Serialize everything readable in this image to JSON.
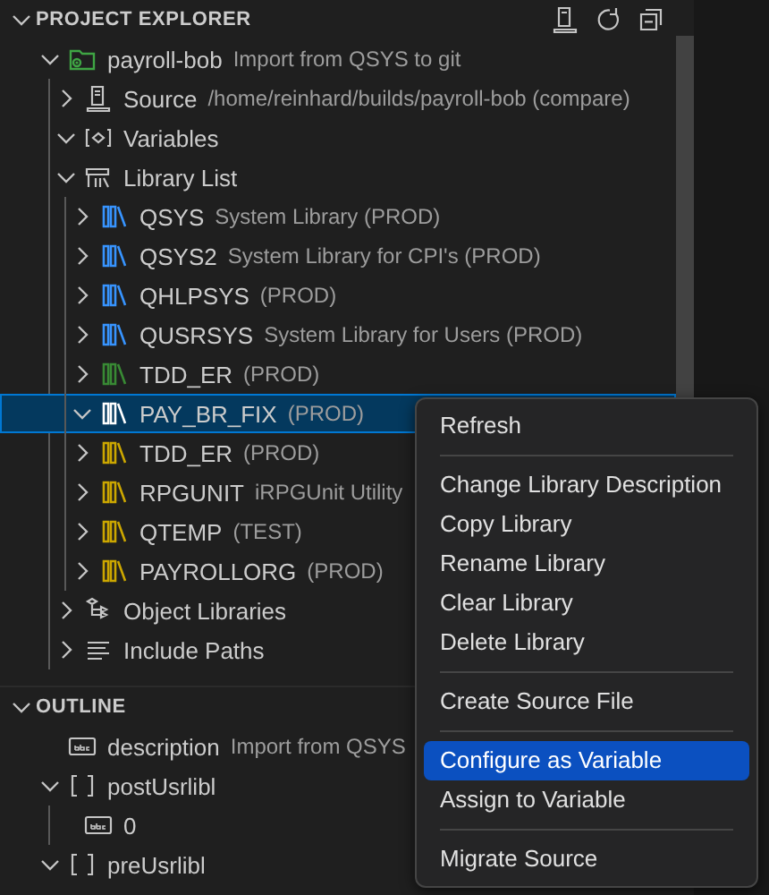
{
  "explorer": {
    "title": "PROJECT EXPLORER",
    "expanded": true,
    "tree": [
      {
        "kind": "project",
        "label": "payroll-bob",
        "description": "Import from QSYS to git",
        "expanded": true,
        "selected": false,
        "children": [
          {
            "kind": "source",
            "label": "Source",
            "description": "/home/reinhard/builds/payroll-bob (compare)",
            "expanded": false,
            "selected": false
          },
          {
            "kind": "variables",
            "label": "Variables",
            "expanded": true,
            "selected": false
          },
          {
            "kind": "library-list",
            "label": "Library List",
            "expanded": true,
            "selected": false,
            "children": [
              {
                "kind": "library",
                "label": "QSYS",
                "description": "System Library (PROD)",
                "color": "#3794ff",
                "expanded": false,
                "selected": false
              },
              {
                "kind": "library",
                "label": "QSYS2",
                "description": "System Library for CPI's (PROD)",
                "color": "#3794ff",
                "expanded": false,
                "selected": false
              },
              {
                "kind": "library",
                "label": "QHLPSYS",
                "description": "(PROD)",
                "color": "#3794ff",
                "expanded": false,
                "selected": false
              },
              {
                "kind": "library",
                "label": "QUSRSYS",
                "description": "System Library for Users (PROD)",
                "color": "#3794ff",
                "expanded": false,
                "selected": false
              },
              {
                "kind": "library",
                "label": "TDD_ER",
                "description": "(PROD)",
                "color": "#388a34",
                "expanded": false,
                "selected": false
              },
              {
                "kind": "library",
                "label": "PAY_BR_FIX",
                "description": "(PROD)",
                "color": "#ffffff",
                "expanded": true,
                "selected": true
              },
              {
                "kind": "library",
                "label": "TDD_ER",
                "description": "(PROD)",
                "color": "#cca700",
                "expanded": false,
                "selected": false
              },
              {
                "kind": "library",
                "label": "RPGUNIT",
                "description": "iRPGUnit Utility",
                "color": "#cca700",
                "expanded": false,
                "selected": false
              },
              {
                "kind": "library",
                "label": "QTEMP",
                "description": "(TEST)",
                "color": "#cca700",
                "expanded": false,
                "selected": false
              },
              {
                "kind": "library",
                "label": "PAYROLLORG",
                "description": "(PROD)",
                "color": "#cca700",
                "expanded": false,
                "selected": false
              }
            ]
          },
          {
            "kind": "object-libraries",
            "label": "Object Libraries",
            "expanded": false,
            "selected": false
          },
          {
            "kind": "include-paths",
            "label": "Include Paths",
            "expanded": false,
            "selected": false
          }
        ]
      }
    ]
  },
  "outline": {
    "title": "OUTLINE",
    "expanded": true,
    "tree": [
      {
        "kind": "string",
        "label": "description",
        "description": "Import from QSYS"
      },
      {
        "kind": "array",
        "label": "postUsrlibl",
        "expanded": true,
        "children": [
          {
            "kind": "string",
            "label": "0"
          }
        ]
      },
      {
        "kind": "array",
        "label": "preUsrlibl",
        "expanded": true
      }
    ]
  },
  "context_menu": {
    "groups": [
      [
        {
          "label": "Refresh",
          "selected": false
        }
      ],
      [
        {
          "label": "Change Library Description",
          "selected": false
        },
        {
          "label": "Copy Library",
          "selected": false
        },
        {
          "label": "Rename Library",
          "selected": false
        },
        {
          "label": "Clear Library",
          "selected": false
        },
        {
          "label": "Delete Library",
          "selected": false
        }
      ],
      [
        {
          "label": "Create Source File",
          "selected": false
        }
      ],
      [
        {
          "label": "Configure as Variable",
          "selected": true
        },
        {
          "label": "Assign to Variable",
          "selected": false
        }
      ],
      [
        {
          "label": "Migrate Source",
          "selected": false
        }
      ]
    ]
  }
}
